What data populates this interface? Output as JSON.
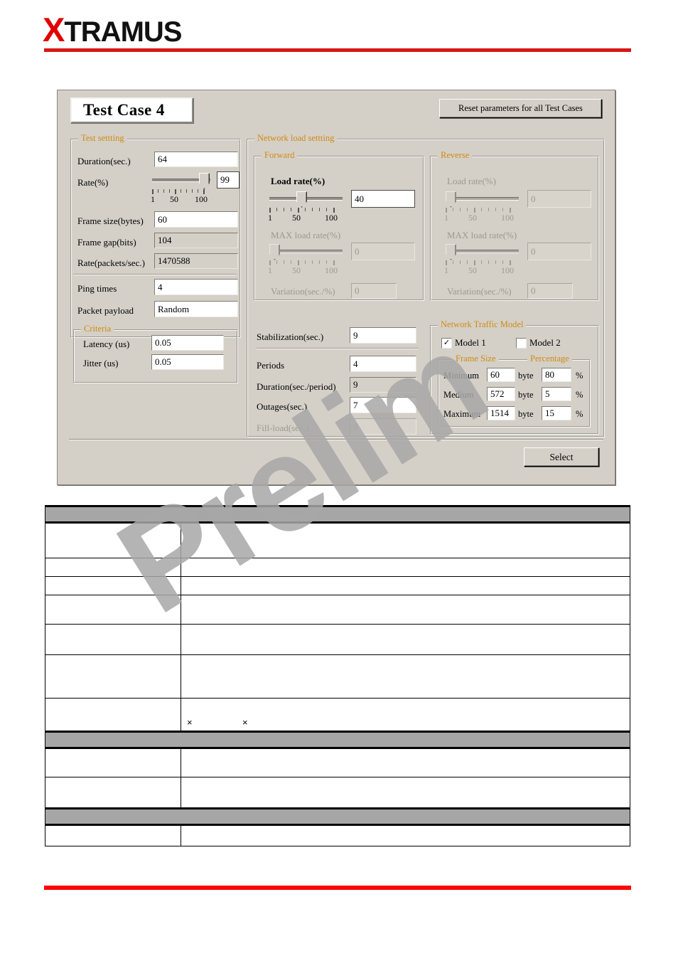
{
  "header": {
    "logo_x": "X",
    "logo_text": "TRAMUS"
  },
  "watermark": {
    "text": "Prelim"
  },
  "dialog": {
    "title": "Test Case 4",
    "reset_button": "Reset parameters for all Test Cases",
    "select_button": "Select",
    "test_setting": {
      "legend": "Test settting",
      "duration_label": "Duration(sec.)",
      "duration_value": "64",
      "rate_label": "Rate(%)",
      "rate_value": "99",
      "rate_ticks": [
        "1",
        "50",
        "100"
      ],
      "frame_size_label": "Frame size(bytes)",
      "frame_size_value": "60",
      "frame_gap_label": "Frame gap(bits)",
      "frame_gap_value": "104",
      "rate_pps_label": "Rate(packets/sec.)",
      "rate_pps_value": "1470588",
      "ping_times_label": "Ping times",
      "ping_times_value": "4",
      "packet_payload_label": "Packet payload",
      "packet_payload_value": "Random",
      "criteria": {
        "legend": "Criteria",
        "latency_label": "Latency (us)",
        "latency_value": "0.05",
        "jitter_label": "Jitter (us)",
        "jitter_value": "0.05"
      }
    },
    "network_load": {
      "legend": "Network load settting",
      "forward": {
        "legend": "Forward",
        "load_rate_label": "Load rate(%)",
        "load_rate_value": "40",
        "load_rate_ticks": [
          "1",
          "50",
          "100"
        ],
        "max_load_rate_label": "MAX load rate(%)",
        "max_load_rate_value": "0",
        "max_load_rate_ticks": [
          "1",
          "50",
          "100"
        ],
        "variation_label": "Variation(sec./%)",
        "variation_value": "0"
      },
      "reverse": {
        "legend": "Reverse",
        "load_rate_label": "Load rate(%)",
        "load_rate_value": "0",
        "load_rate_ticks": [
          "1",
          "50",
          "100"
        ],
        "max_load_rate_label": "MAX load rate(%)",
        "max_load_rate_value": "0",
        "max_load_rate_ticks": [
          "1",
          "50",
          "100"
        ],
        "variation_label": "Variation(sec./%)",
        "variation_value": "0"
      },
      "stabilization_label": "Stabilization(sec.)",
      "stabilization_value": "9",
      "periods_label": "Periods",
      "periods_value": "4",
      "duration_period_label": "Duration(sec./period)",
      "duration_period_value": "9",
      "outages_label": "Outages(sec.)",
      "outages_value": "7",
      "fill_load_label": "Fill-load(sec.)",
      "fill_load_value": "0"
    },
    "traffic_model": {
      "legend": "Network Traffic Model",
      "model1_label": "Model 1",
      "model1_checked": "✓",
      "model2_label": "Model 2",
      "model2_checked": "",
      "frame_size_legend": "Frame Size",
      "percentage_legend": "Percentage",
      "unit_byte": "byte",
      "unit_percent": "%",
      "rows": [
        {
          "name": "Minimum",
          "size": "60",
          "percent": "80"
        },
        {
          "name": "Medium",
          "size": "572",
          "percent": "5"
        },
        {
          "name": "Maximum",
          "size": "1514",
          "percent": "15"
        }
      ]
    }
  },
  "table": {
    "x_mark_1": "×",
    "x_mark_2": "×"
  },
  "colors": {
    "accent_red": "#d81616",
    "footer_red": "#fb0707",
    "group_label": "#d08a10",
    "dialog_bg": "#d4d0c8",
    "band_grey": "#a6a6a6"
  }
}
